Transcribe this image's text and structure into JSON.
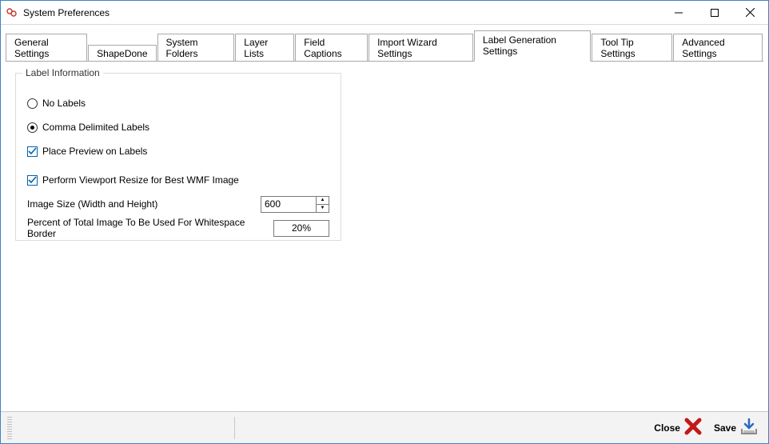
{
  "window": {
    "title": "System Preferences"
  },
  "tabs": [
    {
      "label": "General Settings"
    },
    {
      "label": "ShapeDone"
    },
    {
      "label": "System Folders"
    },
    {
      "label": "Layer Lists"
    },
    {
      "label": "Field Captions"
    },
    {
      "label": "Import Wizard Settings"
    },
    {
      "label": "Label Generation Settings"
    },
    {
      "label": "Tool Tip Settings"
    },
    {
      "label": "Advanced Settings"
    }
  ],
  "active_tab_index": 6,
  "group": {
    "legend": "Label Information",
    "radio_no_labels": "No Labels",
    "radio_comma": "Comma Delimited Labels",
    "selected_radio": "comma",
    "chk_preview": {
      "label": "Place Preview on Labels",
      "checked": true
    },
    "chk_viewport": {
      "label": "Perform Viewport Resize for Best WMF Image",
      "checked": true
    },
    "image_size": {
      "label": "Image Size (Width and Height)",
      "value": "600"
    },
    "whitespace": {
      "label": "Percent of Total Image To Be Used For Whitespace Border",
      "value": "20%"
    }
  },
  "footer": {
    "close": "Close",
    "save": "Save"
  }
}
